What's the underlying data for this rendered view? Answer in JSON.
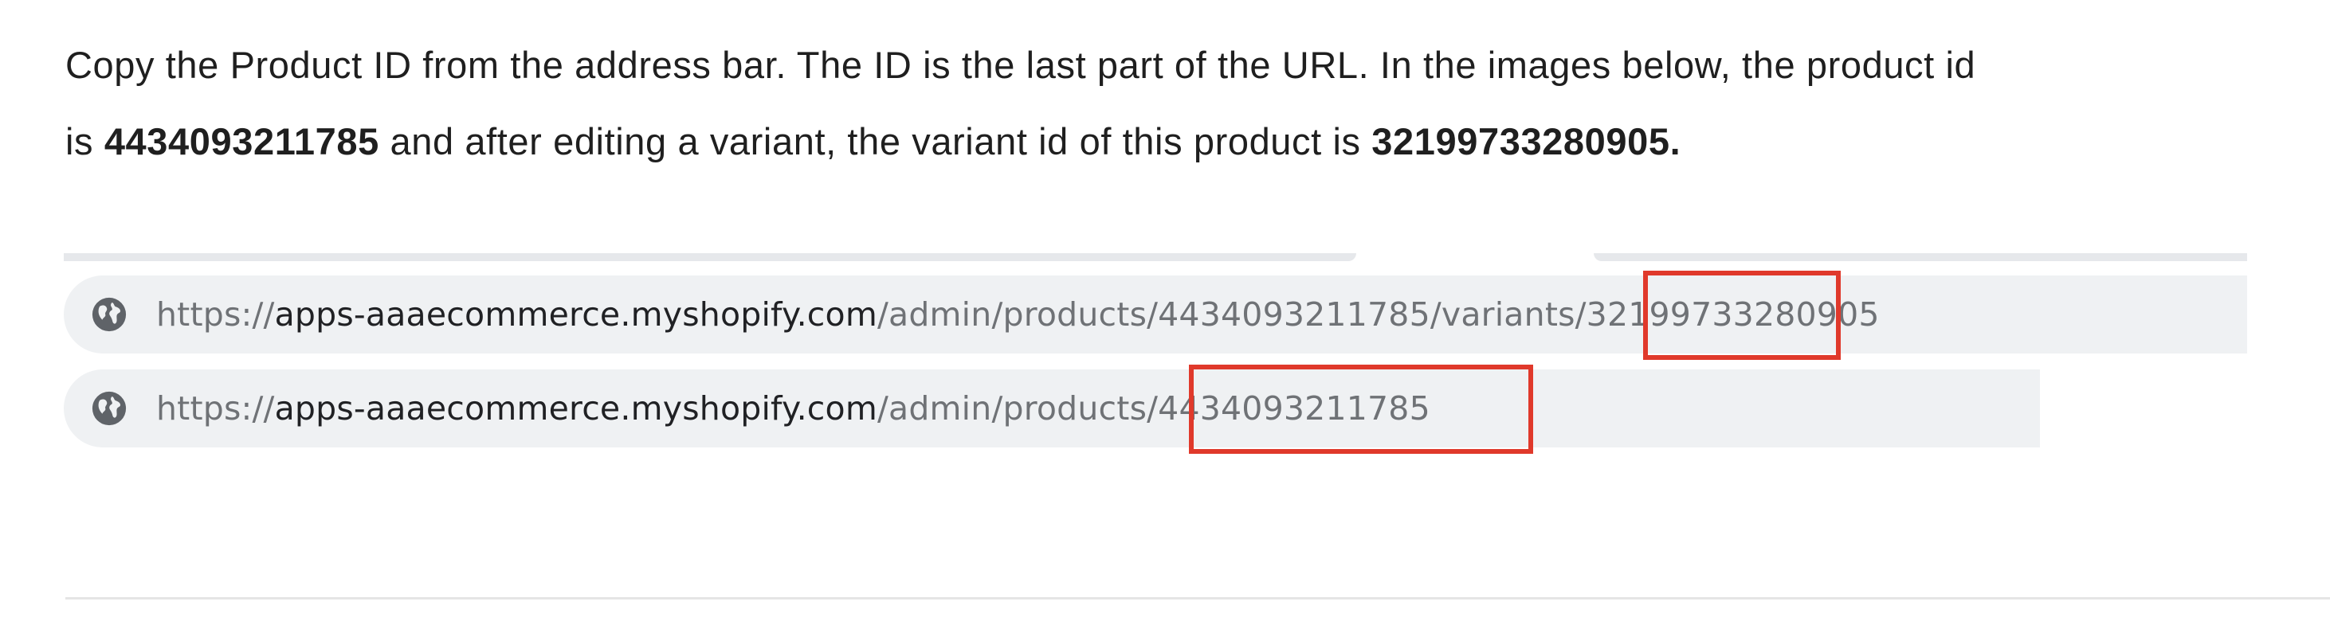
{
  "instructions": {
    "line1": "Copy the Product ID from the address bar. The ID is the last part of the URL. In the images below, the product id",
    "line2_prefix": "is ",
    "product_id": "4434093211785",
    "line2_middle": " and after editing a variant, the variant id of this product is ",
    "variant_id": "32199733280905."
  },
  "url_bar_1": {
    "scheme": "https://",
    "host": "apps-aaaecommerce.myshopify.com",
    "path_before": "/admin/products/4434093211785/variants",
    "path_highlight": "/32199733280905",
    "icon": "globe-icon"
  },
  "url_bar_2": {
    "scheme": "https://",
    "host": "apps-aaaecommerce.myshopify.com",
    "path_before": "/admin/products",
    "path_highlight": "/4434093211785",
    "icon": "globe-icon"
  },
  "colors": {
    "highlight_border": "#e0392b",
    "url_bar_bg": "#eff1f3",
    "url_path_text": "#6f7276",
    "url_host_text": "#202124"
  }
}
